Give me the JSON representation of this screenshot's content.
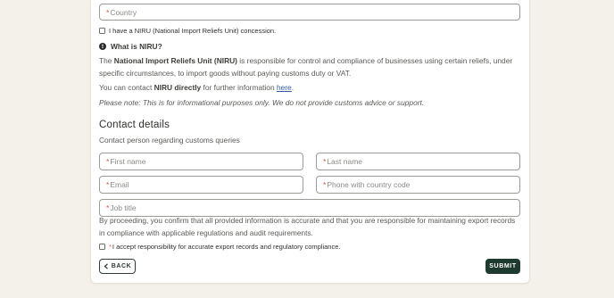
{
  "form": {
    "country_placeholder": "Country",
    "niru_checkbox_label": "I have a NIRU (National Import Reliefs Unit) concession.",
    "what_is_niru": "What is NIRU?",
    "niru_desc": {
      "bold1": "National Import Reliefs Unit (NIRU)",
      "prefix": "The ",
      "line1_rest": " is responsible for control and compliance of businesses using certain reliefs, under",
      "line2": "specific circumstances, to import goods without paying customs duty or VAT."
    },
    "contact_line": {
      "prefix": "You can contact ",
      "bold": "NIRU directly",
      "middle": " for further information ",
      "link": "here",
      "suffix": "."
    },
    "note": "Please note: This is for informational purposes only. We do not provide customs advice or support.",
    "contact_heading": "Contact details",
    "contact_subtitle": "Contact person regarding customs queries",
    "first_name_placeholder": "First name",
    "last_name_placeholder": "Last name",
    "email_placeholder": "Email",
    "phone_placeholder": "Phone with country code",
    "job_title_placeholder": "Job title",
    "disclaimer_line1": "By proceeding, you confirm that all provided information is accurate and that you are responsible for maintaining export records",
    "disclaimer_line2": "in compliance with applicable regulations and audit requirements.",
    "accept_label": "I accept responsibility for accurate export records and regulatory compliance.",
    "back_label": "BACK",
    "submit_label": "SUBMIT",
    "required_marker": "*"
  },
  "colors": {
    "background": "#f4f1ea",
    "card": "#ffffff",
    "submit": "#1f3a2e",
    "required": "#d9534f",
    "link": "#2f5ea8"
  }
}
